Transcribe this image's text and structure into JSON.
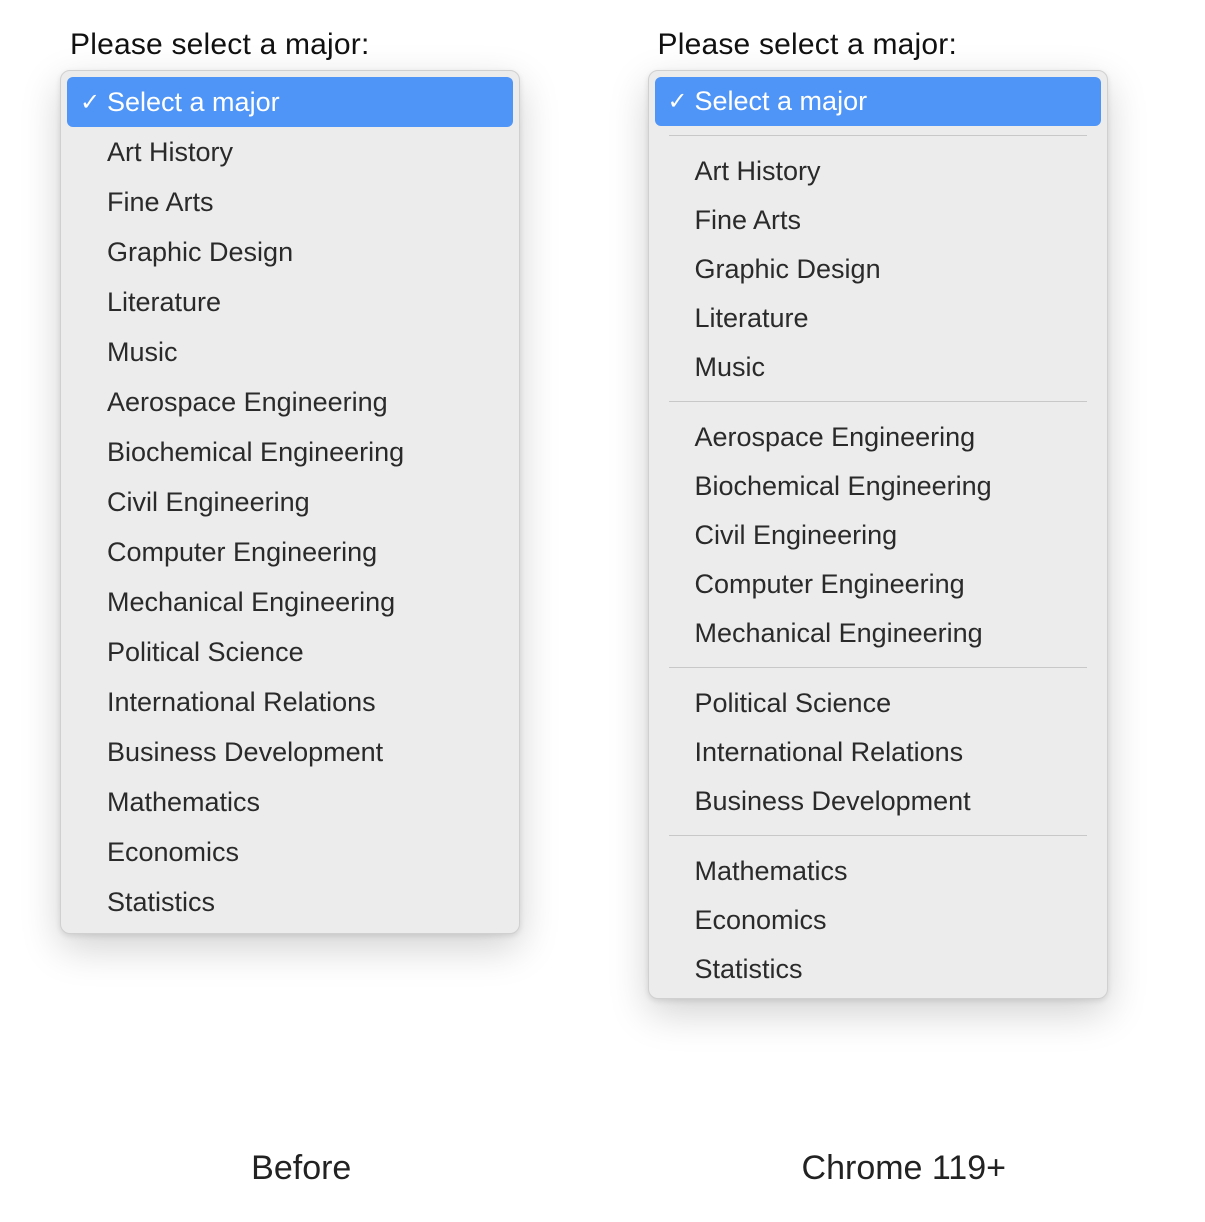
{
  "prompt": "Please select a major:",
  "selected_label": "Select a major",
  "captions": {
    "before": "Before",
    "after": "Chrome 119+"
  },
  "before": {
    "items": [
      "Select a major",
      "Art History",
      "Fine Arts",
      "Graphic Design",
      "Literature",
      "Music",
      "Aerospace Engineering",
      "Biochemical Engineering",
      "Civil Engineering",
      "Computer Engineering",
      "Mechanical Engineering",
      "Political Science",
      "International Relations",
      "Business Development",
      "Mathematics",
      "Economics",
      "Statistics"
    ]
  },
  "after": {
    "groups": [
      [
        "Select a major"
      ],
      [
        "Art History",
        "Fine Arts",
        "Graphic Design",
        "Literature",
        "Music"
      ],
      [
        "Aerospace Engineering",
        "Biochemical Engineering",
        "Civil Engineering",
        "Computer Engineering",
        "Mechanical Engineering"
      ],
      [
        "Political Science",
        "International Relations",
        "Business Development"
      ],
      [
        "Mathematics",
        "Economics",
        "Statistics"
      ]
    ]
  }
}
